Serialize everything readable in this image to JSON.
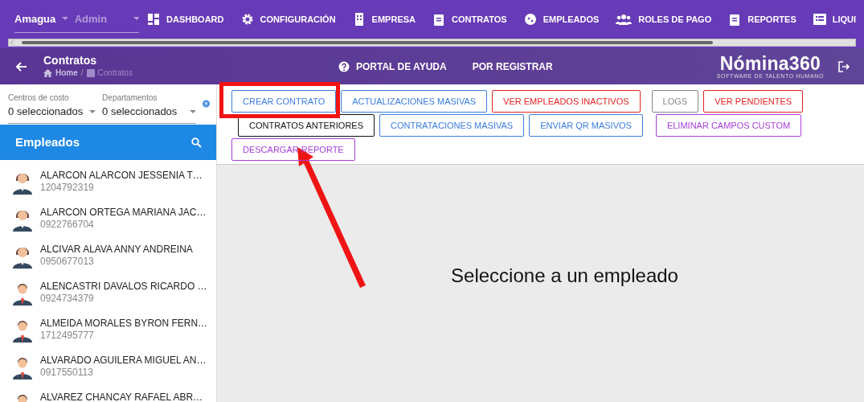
{
  "top_nav": {
    "company": "Amagua",
    "role": "Admin",
    "items": [
      "DASHBOARD",
      "CONFIGURACIÓN",
      "EMPRESA",
      "CONTRATOS",
      "EMPLEADOS",
      "ROLES DE PAGO",
      "REPORTES",
      "LIQUI"
    ]
  },
  "header": {
    "title": "Contratos",
    "breadcrumb": [
      "Home",
      "Contratos"
    ],
    "breadcrumb_separator": "/",
    "links": [
      "PORTAL DE AYUDA",
      "POR REGISTRAR"
    ],
    "logo": "Nómina360",
    "logo_tagline": "SOFTWARE DE TALENTO HUMANO"
  },
  "filters": [
    {
      "label": "Centros de costo",
      "value": "0 seleccionados"
    },
    {
      "label": "Departamentos",
      "value": "0 seleccionados"
    }
  ],
  "employees_panel": {
    "title": "Empleados",
    "employees": [
      {
        "name": "ALARCON ALARCON JESSENIA T…",
        "id": "1204792319",
        "kind": "female"
      },
      {
        "name": "ALARCON ORTEGA MARIANA JAC…",
        "id": "0922766704",
        "kind": "female"
      },
      {
        "name": "ALCIVAR ALAVA ANNY ANDREINA",
        "id": "0950677013",
        "kind": "female"
      },
      {
        "name": "ALENCASTRI DAVALOS RICARDO …",
        "id": "0924734379",
        "kind": "male"
      },
      {
        "name": "ALMEIDA MORALES BYRON FERN…",
        "id": "1712495777",
        "kind": "male"
      },
      {
        "name": "ALVARADO AGUILERA MIGUEL AN…",
        "id": "0917550113",
        "kind": "male"
      },
      {
        "name": "ALVAREZ CHANCAY RAFAEL ABR…",
        "kind": "male"
      }
    ]
  },
  "actions": [
    {
      "label": "CREAR CONTRATO",
      "color": "#3b7ddd"
    },
    {
      "label": "ACTUALIZACIONES MASIVAS",
      "color": "#3b7ddd"
    },
    {
      "label": "VER EMPLEADOS INACTIVOS",
      "color": "#e02424"
    },
    {
      "label": "LOGS",
      "color": "#888888"
    },
    {
      "label": "VER PENDIENTES",
      "color": "#e02424"
    },
    {
      "label": "CONTRATOS ANTERIORES",
      "color": "#111111"
    },
    {
      "label": "CONTRATACIONES MASIVAS",
      "color": "#3b7ddd"
    },
    {
      "label": "ENVIAR QR MASIVOS",
      "color": "#3b7ddd"
    },
    {
      "label": "ELIMINAR CAMPOS CUSTOM",
      "color": "#a63fd9"
    },
    {
      "label": "DESCARGAR REPORTE",
      "color": "#a63fd9"
    }
  ],
  "empty_message": "Seleccione a un empleado"
}
